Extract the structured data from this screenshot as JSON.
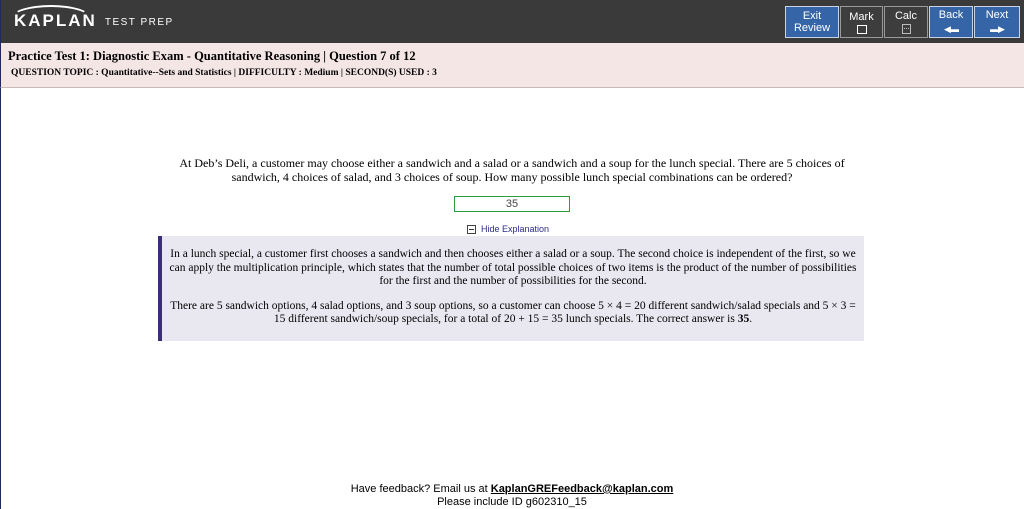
{
  "brand": {
    "name": "KAPLAN",
    "sub": "TEST PREP"
  },
  "toolbar": {
    "exit_line1": "Exit",
    "exit_line2": "Review",
    "mark": "Mark",
    "calc": "Calc",
    "back": "Back",
    "next": "Next"
  },
  "header": {
    "title": "Practice Test 1: Diagnostic Exam - Quantitative Reasoning | Question 7 of 12",
    "subtitle": "QUESTION TOPIC : Quantitative--Sets and Statistics | DIFFICULTY : Medium | SECOND(S) USED : 3"
  },
  "question": {
    "text": "At Deb’s Deli, a customer may choose either a sandwich and a salad or a sandwich and a soup for the lunch special. There are 5 choices of sandwich, 4 choices of salad, and 3 choices of soup. How many possible lunch special combinations can be ordered?",
    "answer_value": "35"
  },
  "explanation": {
    "toggle_label": "Hide Explanation",
    "para1": "In a lunch special, a customer first chooses a sandwich and then chooses either a salad or a soup. The second choice is independent of the first, so we can apply the multiplication principle, which states that the number of total possible choices of two items is the product of the number of possibilities for the first and the number of possibilities for the second.",
    "para2_main": "There are 5 sandwich options, 4 salad options, and 3 soup options, so a customer can choose 5 × 4 = 20 different sandwich/salad specials and 5 × 3 = 15 different sandwich/soup specials, for a total of 20 + 15 = 35 lunch specials. The correct answer is ",
    "para2_answer": "35",
    "para2_end": "."
  },
  "footer": {
    "line1_prefix": "Have feedback? Email us at ",
    "email": "KaplanGREFeedback@kaplan.com",
    "line2": "Please include ID g602310_15"
  },
  "colors": {
    "topbar": "#3a3a3a",
    "button_blue": "#3565a6",
    "header_bg": "#f5e6e6",
    "explanation_bg": "#e9e8f0",
    "explanation_border": "#3c2d7a",
    "answer_border": "#2e9c3a"
  },
  "icons": {
    "mark": "checkbox-icon",
    "calc": "calculator-icon",
    "back": "back-arrow-icon",
    "next": "next-arrow-icon",
    "toggle": "minus-box-icon"
  }
}
